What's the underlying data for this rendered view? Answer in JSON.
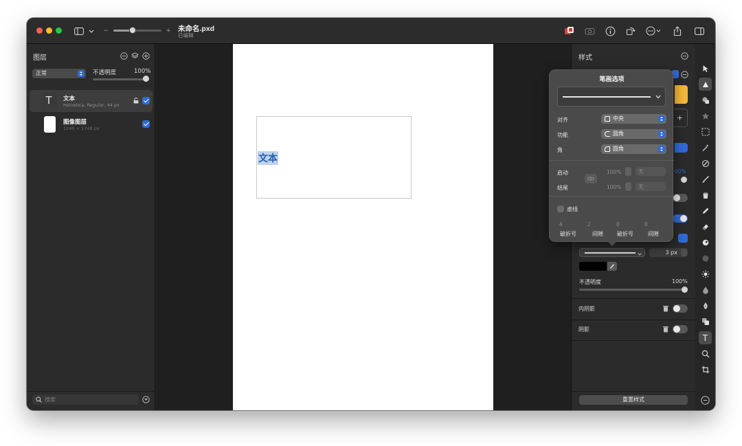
{
  "titlebar": {
    "doc_title": "未命名.pxd",
    "doc_subtitle": "已编辑",
    "zoom_minus": "−",
    "zoom_plus": "+",
    "zoom_level": 0.4
  },
  "layers_panel": {
    "title": "图层",
    "blend_mode": "正常",
    "opacity_label": "不透明度",
    "opacity_value": "100%",
    "layers": [
      {
        "thumb": "T",
        "name": "文本",
        "meta": "Helvetica, Regular, 44 px",
        "visible": true,
        "selected": true
      },
      {
        "thumb": "",
        "name": "图像图层",
        "meta": "1240 × 1748 px",
        "visible": true,
        "selected": false
      }
    ],
    "search_placeholder": "搜索"
  },
  "canvas": {
    "text_content": "文本"
  },
  "style_panel": {
    "title": "样式",
    "accent_color": "#2f6bd8",
    "fill_swatch_color": "#f5b83a",
    "stroke_width": "3 px",
    "stroke_color": "#000000",
    "opacity_label": "不透明度",
    "opacity_value": "100%",
    "partial_opacity": "00%",
    "inner_shadow_label": "内阴影",
    "shadow_label": "阴影",
    "reset_button": "重置样式"
  },
  "stroke_popover": {
    "title": "笔画选项",
    "align_label": "对齐",
    "align_value": "中央",
    "cap_label": "功能",
    "cap_value": "圆角",
    "corner_label": "角",
    "corner_value": "圆角",
    "start_label": "启动",
    "start_percent": "100%",
    "start_value": "无",
    "end_label": "结尾",
    "end_percent": "100%",
    "end_value": "无",
    "dashed_label": "虚线",
    "dash_values": [
      "4",
      "2",
      "0",
      "0"
    ],
    "dash_labels": [
      "破折号",
      "间隙",
      "破折号",
      "间隙"
    ]
  },
  "tools": [
    "arrange-icon",
    "style-icon",
    "shapes-icon",
    "star-icon",
    "selection-icon",
    "magic-wand-icon",
    "retouch-icon",
    "brush-icon",
    "paint-bucket-icon",
    "pencil-icon",
    "eraser-icon",
    "clone-icon",
    "blur-icon",
    "light-icon",
    "sharpen-icon",
    "pen-icon",
    "combine-icon",
    "text-icon",
    "zoom-icon",
    "crop-icon",
    "more-icon"
  ]
}
